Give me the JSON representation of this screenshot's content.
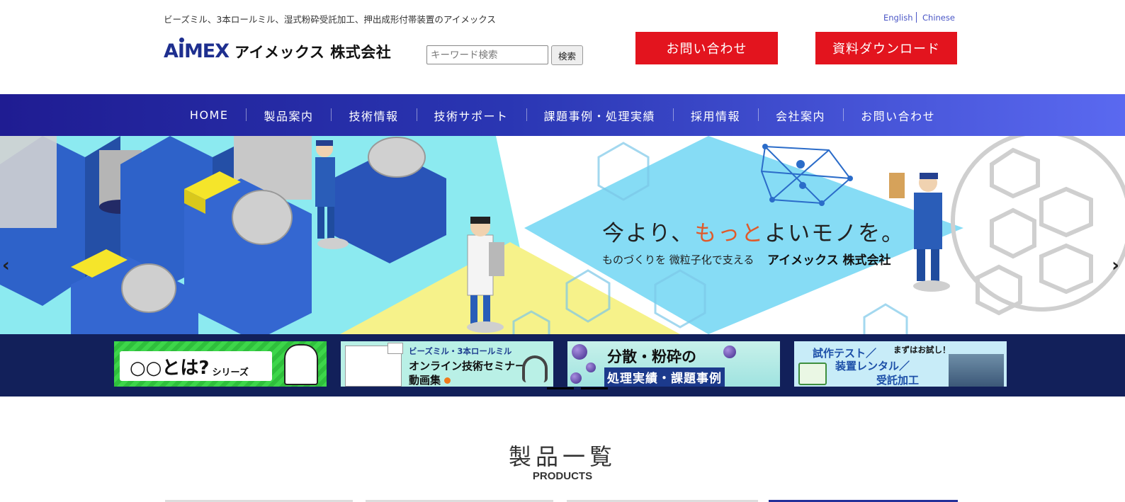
{
  "header": {
    "tagline": "ビーズミル、3本ロールミル、湿式粉砕受託加工、押出成形付帯装置のアイメックス",
    "logo_mark": "AIMEX",
    "logo_text": "アイメックス 株式会社",
    "search": {
      "placeholder": "キーワード検索",
      "button": "検索"
    },
    "languages": [
      "English",
      "Chinese"
    ],
    "contact_button": "お問い合わせ",
    "download_button": "資料ダウンロード"
  },
  "nav": {
    "items": [
      "HOME",
      "製品案内",
      "技術情報",
      "技術サポート",
      "課題事例・処理実績",
      "採用情報",
      "会社案内",
      "お問い合わせ"
    ]
  },
  "hero": {
    "copy_part1": "今より、",
    "copy_accent": "もっと",
    "copy_part2": "よいモノを。",
    "sub": "ものづくりを 微粒子化で支える",
    "sub_company": "アイメックス 株式会社",
    "prev_arrow": "‹",
    "next_arrow": "›",
    "accent_color": "#e05a2a"
  },
  "banners": [
    {
      "title": "○○とは?",
      "small": "シリーズ"
    },
    {
      "line1": "ビーズミル・3本ロールミル",
      "line2": "オンライン技術セミナー",
      "line3": "動画集"
    },
    {
      "line1": "分散・粉砕の",
      "line2": "処理実績・課題事例"
    },
    {
      "line0": "まずはお試し！",
      "line1": "試作テスト／",
      "line2": "装置レンタル／",
      "line3": "受託加工"
    }
  ],
  "products": {
    "title": "製品一覧",
    "subtitle": "PRODUCTS"
  },
  "colors": {
    "brand": "#1e2f8f",
    "cta_red": "#e3141e",
    "nav_gradient_start": "#1f1c92",
    "nav_gradient_end": "#5a69f0",
    "strip_bg": "#12205a"
  }
}
